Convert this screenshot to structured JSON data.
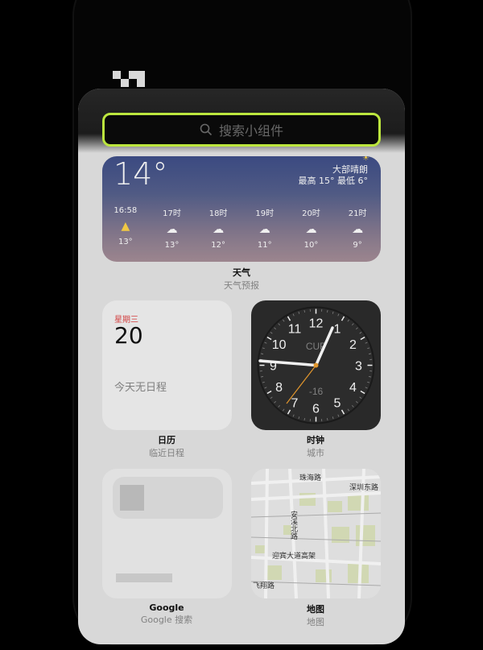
{
  "search": {
    "placeholder": "搜索小组件"
  },
  "weather": {
    "temp": "14°",
    "condition": "大部晴朗",
    "hilo": "最高 15° 最低 6°",
    "hours": [
      {
        "time": "16:58",
        "icon": "sunset-icon",
        "temp": "13°"
      },
      {
        "time": "17时",
        "icon": "cloud-icon",
        "temp": "13°"
      },
      {
        "time": "18时",
        "icon": "cloud-icon",
        "temp": "12°"
      },
      {
        "time": "19时",
        "icon": "cloud-moon-icon",
        "temp": "11°"
      },
      {
        "time": "20时",
        "icon": "cloud-moon-icon",
        "temp": "10°"
      },
      {
        "time": "21时",
        "icon": "cloud-moon-icon",
        "temp": "9°"
      }
    ],
    "caption_title": "天气",
    "caption_sub": "天气预报"
  },
  "calendar": {
    "weekday": "星期三",
    "day": "20",
    "empty": "今天无日程",
    "caption_title": "日历",
    "caption_sub": "临近日程"
  },
  "clock": {
    "city": "CUP",
    "offset": "-16",
    "caption_title": "时钟",
    "caption_sub": "城市"
  },
  "google": {
    "caption_title": "Google",
    "caption_sub": "Google 搜索"
  },
  "map": {
    "roads": [
      "珠海路",
      "深圳东路",
      "安溪北路",
      "迎宾大道高架",
      "飞翔路"
    ],
    "caption_title": "地图",
    "caption_sub": "地图"
  },
  "colors": {
    "accent": "#c8f542",
    "calendar_red": "#e04545"
  }
}
